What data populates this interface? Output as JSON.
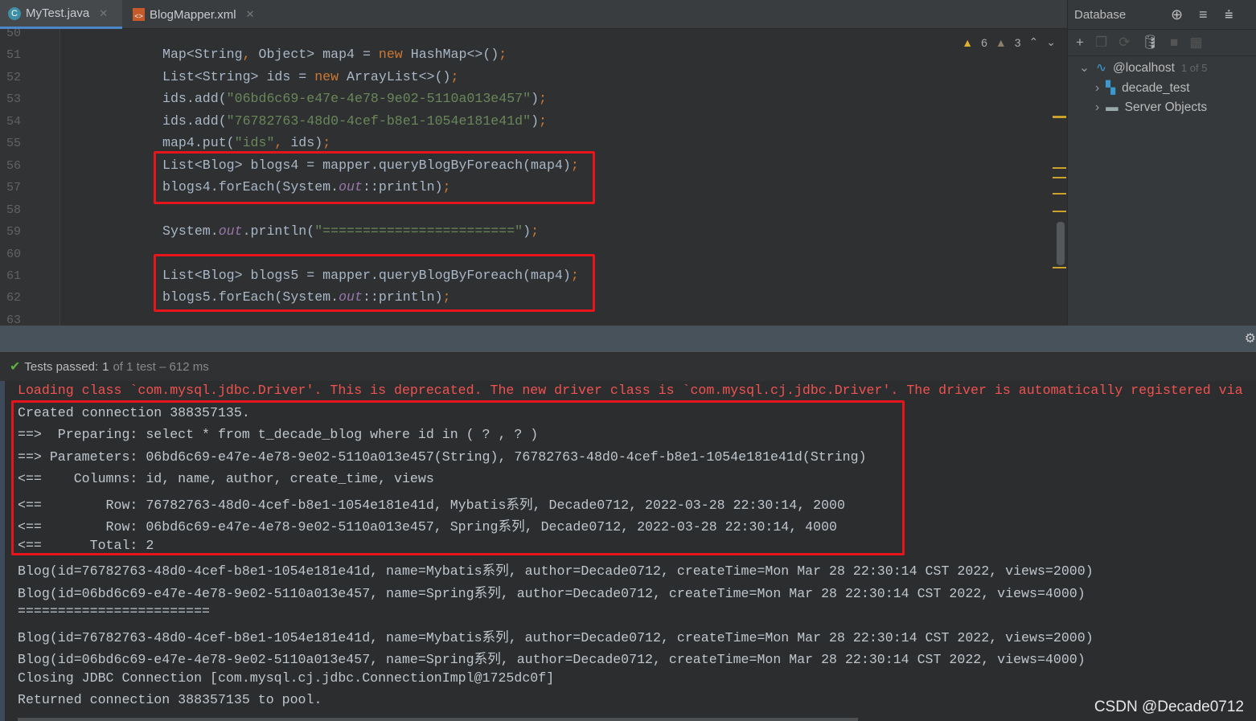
{
  "tabs": [
    {
      "label": "MyTest.java",
      "icon": "java-class-icon",
      "active": true
    },
    {
      "label": "BlogMapper.xml",
      "icon": "xml-file-icon",
      "active": false
    }
  ],
  "editor": {
    "first_line": 50,
    "inspections": {
      "warnings": "6",
      "weak_warnings": "3"
    },
    "lines": [
      {
        "n": "50",
        "tokens": []
      },
      {
        "n": "51",
        "tokens": [
          [
            "p",
            "Map<String"
          ],
          [
            "k",
            ", "
          ],
          [
            "p",
            "Object> map4 = "
          ],
          [
            "k",
            "new "
          ],
          [
            "p",
            "HashMap<>()"
          ],
          [
            "k",
            ";"
          ]
        ]
      },
      {
        "n": "52",
        "tokens": [
          [
            "p",
            "List<String> ids = "
          ],
          [
            "k",
            "new "
          ],
          [
            "p",
            "ArrayList<>()"
          ],
          [
            "k",
            ";"
          ]
        ]
      },
      {
        "n": "53",
        "tokens": [
          [
            "p",
            "ids.add("
          ],
          [
            "s",
            "\"06bd6c69-e47e-4e78-9e02-5110a013e457\""
          ],
          [
            "p",
            ")"
          ],
          [
            "k",
            ";"
          ]
        ]
      },
      {
        "n": "54",
        "tokens": [
          [
            "p",
            "ids.add("
          ],
          [
            "s",
            "\"76782763-48d0-4cef-b8e1-1054e181e41d\""
          ],
          [
            "p",
            ")"
          ],
          [
            "k",
            ";"
          ]
        ]
      },
      {
        "n": "55",
        "tokens": [
          [
            "p",
            "map4.put("
          ],
          [
            "s",
            "\"ids\""
          ],
          [
            "k",
            ", "
          ],
          [
            "p",
            "ids)"
          ],
          [
            "k",
            ";"
          ]
        ]
      },
      {
        "n": "56",
        "tokens": [
          [
            "p",
            "List<Blog> blogs4 = mapper.queryBlogByForeach(map4)"
          ],
          [
            "k",
            ";"
          ]
        ]
      },
      {
        "n": "57",
        "tokens": [
          [
            "p",
            "blogs4.forEach(System."
          ],
          [
            "i",
            "out"
          ],
          [
            "p",
            "::println)"
          ],
          [
            "k",
            ";"
          ]
        ]
      },
      {
        "n": "58",
        "tokens": []
      },
      {
        "n": "59",
        "tokens": [
          [
            "p",
            "System."
          ],
          [
            "i",
            "out"
          ],
          [
            "p",
            ".println("
          ],
          [
            "s",
            "\"========================\""
          ],
          [
            "p",
            ")"
          ],
          [
            "k",
            ";"
          ]
        ]
      },
      {
        "n": "60",
        "tokens": []
      },
      {
        "n": "61",
        "tokens": [
          [
            "p",
            "List<Blog> blogs5 = mapper.queryBlogByForeach(map4)"
          ],
          [
            "k",
            ";"
          ]
        ]
      },
      {
        "n": "62",
        "tokens": [
          [
            "p",
            "blogs5.forEach(System."
          ],
          [
            "i",
            "out"
          ],
          [
            "p",
            "::println)"
          ],
          [
            "k",
            ";"
          ]
        ]
      },
      {
        "n": "63",
        "tokens": []
      }
    ]
  },
  "database": {
    "title": "Database",
    "tree": [
      {
        "label": "@localhost",
        "extra": "1 of 5",
        "icon": "mysql-icon"
      },
      {
        "label": "decade_test",
        "icon": "schema-icon"
      },
      {
        "label": "Server Objects",
        "icon": "folder-icon"
      }
    ]
  },
  "status": {
    "label": "Tests passed:",
    "count": "1",
    "detail": "of 1 test – 612 ms"
  },
  "console": [
    {
      "err": true,
      "text": "Loading class `com.mysql.jdbc.Driver'. This is deprecated. The new driver class is `com.mysql.cj.jdbc.Driver'. The driver is automatically registered via"
    },
    {
      "text": "Created connection 388357135."
    },
    {
      "text": "==>  Preparing: select * from t_decade_blog where id in ( ? , ? )"
    },
    {
      "text": "==> Parameters: 06bd6c69-e47e-4e78-9e02-5110a013e457(String), 76782763-48d0-4cef-b8e1-1054e181e41d(String)"
    },
    {
      "text": "<==    Columns: id, name, author, create_time, views"
    },
    {
      "text": "<==        Row: 76782763-48d0-4cef-b8e1-1054e181e41d, Mybatis系列, Decade0712, 2022-03-28 22:30:14, 2000"
    },
    {
      "text": "<==        Row: 06bd6c69-e47e-4e78-9e02-5110a013e457, Spring系列, Decade0712, 2022-03-28 22:30:14, 4000"
    },
    {
      "text": "<==      Total: 2"
    },
    {
      "text": "Blog(id=76782763-48d0-4cef-b8e1-1054e181e41d, name=Mybatis系列, author=Decade0712, createTime=Mon Mar 28 22:30:14 CST 2022, views=2000)"
    },
    {
      "text": "Blog(id=06bd6c69-e47e-4e78-9e02-5110a013e457, name=Spring系列, author=Decade0712, createTime=Mon Mar 28 22:30:14 CST 2022, views=4000)"
    },
    {
      "text": "========================"
    },
    {
      "text": "Blog(id=76782763-48d0-4cef-b8e1-1054e181e41d, name=Mybatis系列, author=Decade0712, createTime=Mon Mar 28 22:30:14 CST 2022, views=2000)"
    },
    {
      "text": "Blog(id=06bd6c69-e47e-4e78-9e02-5110a013e457, name=Spring系列, author=Decade0712, createTime=Mon Mar 28 22:30:14 CST 2022, views=4000)"
    },
    {
      "text": "Closing JDBC Connection [com.mysql.cj.jdbc.ConnectionImpl@1725dc0f]"
    },
    {
      "text": "Returned connection 388357135 to pool."
    }
  ],
  "watermark": "CSDN @Decade0712"
}
